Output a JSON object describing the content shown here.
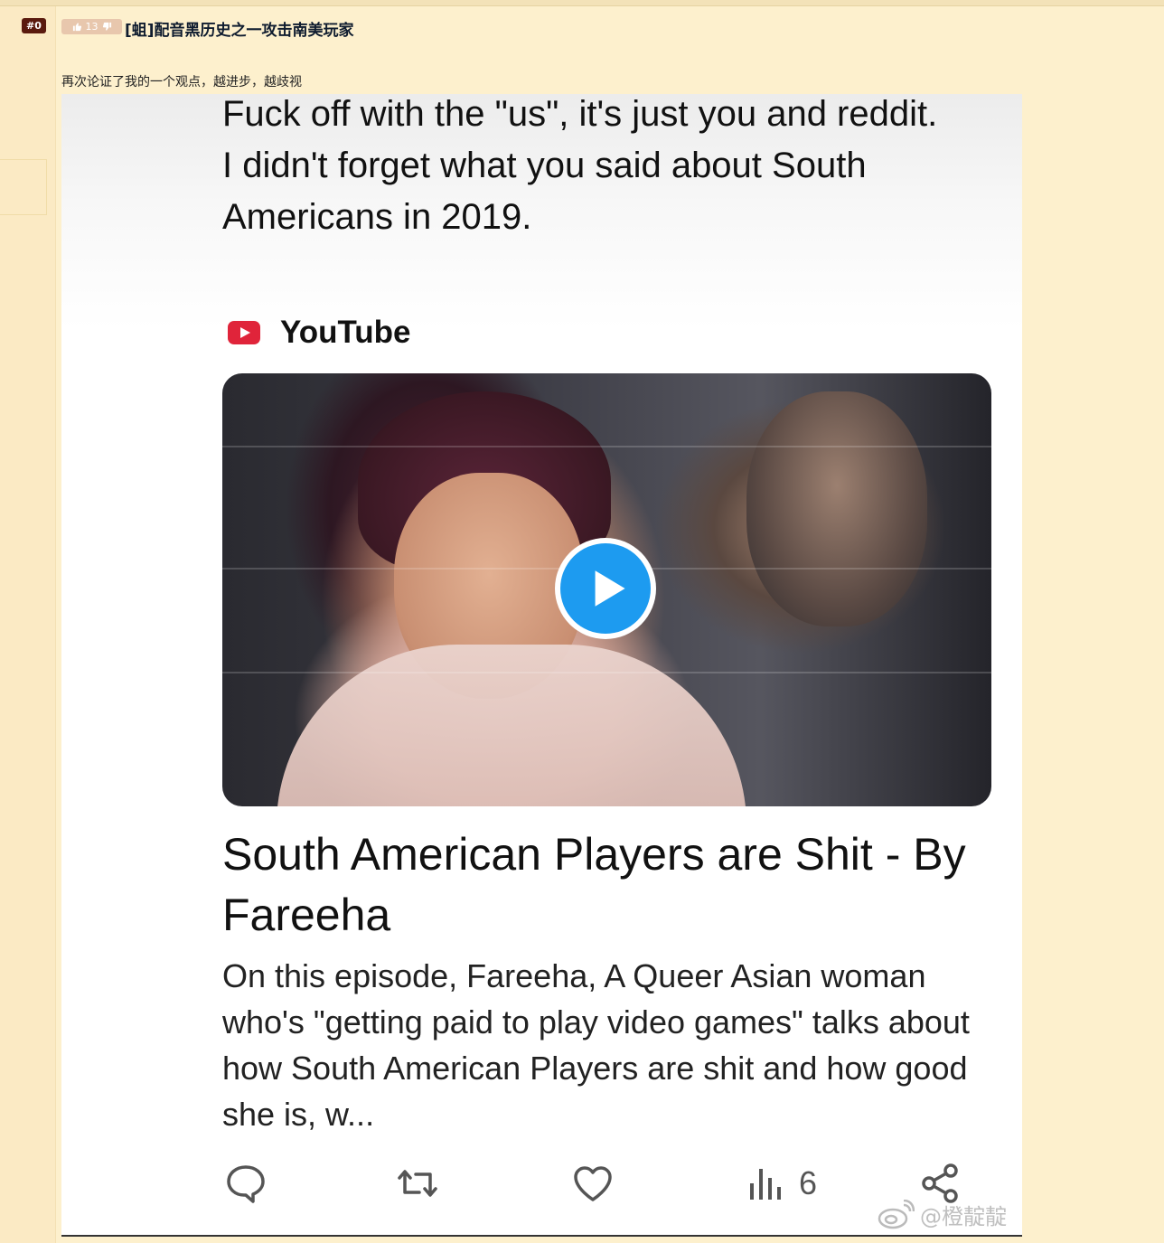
{
  "post": {
    "floor": "#0",
    "votes": "13",
    "title": "[蛆]配音黑历史之一攻击南美玩家",
    "body": "再次论证了我的一个观点，越进步，越歧视"
  },
  "tweet": {
    "text": "Fuck off with the \"us\", it's just you and reddit.\nI didn't forget what you said about South Americans in 2019.",
    "source": "YouTube",
    "card_title": "South American Players are Shit - By Fareeha",
    "card_description": "On this episode, Fareeha, A Queer Asian woman who's \"getting paid to play video games\" talks about how South American Players are shit and how good she is, w...",
    "views": "6"
  },
  "watermark": "@橙靛靛",
  "icons": {
    "upvote": "thumbs-up-icon",
    "downvote": "thumbs-down-icon",
    "youtube": "youtube-logo-icon",
    "play": "play-icon",
    "reply": "reply-icon",
    "retweet": "retweet-icon",
    "like": "heart-icon",
    "views": "views-chart-icon",
    "share": "share-icon",
    "weibo": "weibo-icon"
  },
  "colors": {
    "page_bg": "#fdf0cd",
    "floor_badge": "#5a1a0e",
    "vote_bg": "#e8c7ad",
    "play_blue": "#1d9bf0",
    "youtube_red": "#e0243a"
  }
}
